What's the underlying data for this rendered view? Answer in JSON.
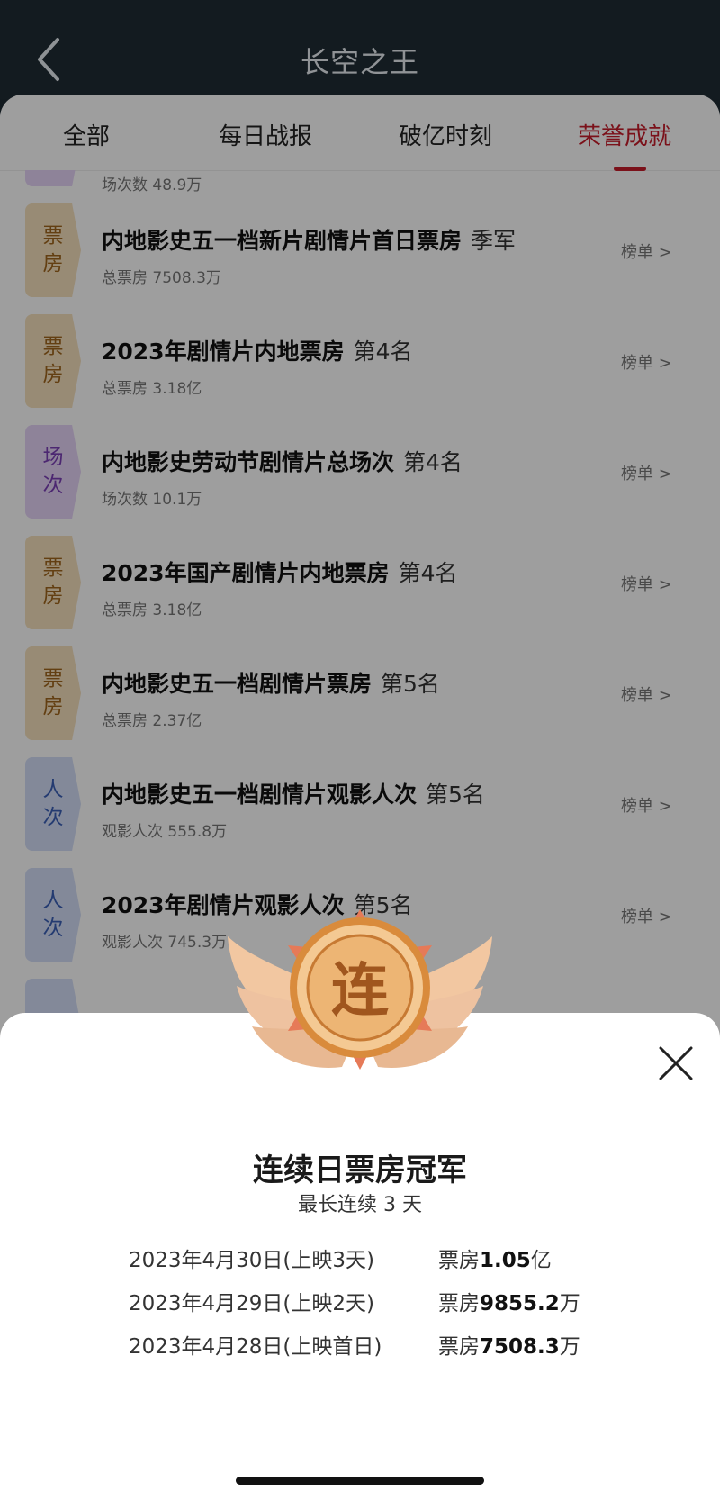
{
  "header": {
    "title": "长空之王"
  },
  "tabs": [
    {
      "label": "全部",
      "active": false
    },
    {
      "label": "每日战报",
      "active": false
    },
    {
      "label": "破亿时刻",
      "active": false
    },
    {
      "label": "荣誉成就",
      "active": true
    }
  ],
  "partial_top": {
    "badge": [
      "场",
      "次"
    ],
    "sub": "场次数 48.9万"
  },
  "rows": [
    {
      "badge": [
        "票",
        "房"
      ],
      "type": "piao",
      "title": "内地影史五一档新片剧情片首日票房",
      "rank": "季军",
      "sub": "总票房 7508.3万",
      "link": "榜单 >"
    },
    {
      "badge": [
        "票",
        "房"
      ],
      "type": "piao",
      "title": "2023年剧情片内地票房",
      "rank": "第4名",
      "sub": "总票房 3.18亿",
      "link": "榜单 >"
    },
    {
      "badge": [
        "场",
        "次"
      ],
      "type": "chang",
      "title": "内地影史劳动节剧情片总场次",
      "rank": "第4名",
      "sub": "场次数 10.1万",
      "link": "榜单 >"
    },
    {
      "badge": [
        "票",
        "房"
      ],
      "type": "piao",
      "title": "2023年国产剧情片内地票房",
      "rank": "第4名",
      "sub": "总票房 3.18亿",
      "link": "榜单 >"
    },
    {
      "badge": [
        "票",
        "房"
      ],
      "type": "piao",
      "title": "内地影史五一档剧情片票房",
      "rank": "第5名",
      "sub": "总票房 2.37亿",
      "link": "榜单 >"
    },
    {
      "badge": [
        "人",
        "次"
      ],
      "type": "ren",
      "title": "内地影史五一档剧情片观影人次",
      "rank": "第5名",
      "sub": "观影人次 555.8万",
      "link": "榜单 >"
    },
    {
      "badge": [
        "人",
        "次"
      ],
      "type": "ren",
      "title": "2023年剧情片观影人次",
      "rank": "第5名",
      "sub": "观影人次 745.3万",
      "link": "榜单 >"
    }
  ],
  "sheet": {
    "medal_char": "连",
    "title": "连续日票房冠军",
    "subtitle": "最长连续 3 天",
    "details": [
      {
        "date": "2023年4月30日(上映3天)",
        "label": "票房",
        "amount": "1.05",
        "unit": "亿"
      },
      {
        "date": "2023年4月29日(上映2天)",
        "label": "票房",
        "amount": "9855.2",
        "unit": "万"
      },
      {
        "date": "2023年4月28日(上映首日)",
        "label": "票房",
        "amount": "7508.3",
        "unit": "万"
      }
    ]
  },
  "icons": {
    "back": "chevron-left-icon",
    "close": "close-icon",
    "medal": "wing-medal-icon"
  },
  "colors": {
    "accent": "#c71c2a",
    "piao_badge": "#f6e1bd",
    "chang_badge": "#e6d3f7",
    "ren_badge": "#d3ddf7"
  }
}
